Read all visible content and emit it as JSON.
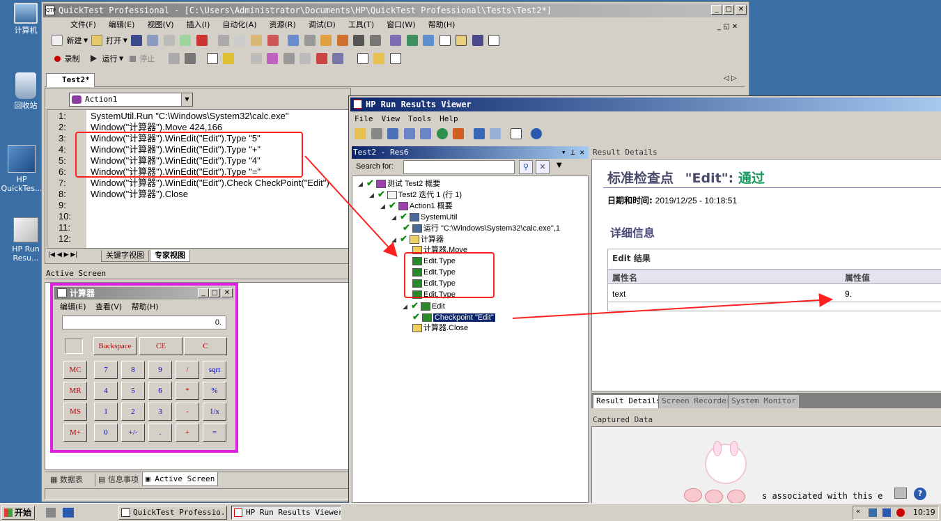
{
  "desktop": {
    "icons": [
      {
        "label": "计算机"
      },
      {
        "label": "回收站"
      },
      {
        "label": "HP QuickTes..."
      },
      {
        "label": "HP Run Resu..."
      }
    ]
  },
  "qtp": {
    "title": "QuickTest Professional - [C:\\Users\\Administrator\\Documents\\HP\\QuickTest Professional\\Tests\\Test2*]",
    "menu": [
      "文件(F)",
      "编辑(E)",
      "视图(V)",
      "插入(I)",
      "自动化(A)",
      "资源(R)",
      "调试(D)",
      "工具(T)",
      "窗口(W)",
      "帮助(H)"
    ],
    "toolbar": {
      "new": "新建",
      "open": "打开",
      "record": "录制",
      "run": "运行",
      "stop": "停止"
    },
    "doc_tab": "Test2*",
    "action_select": "Action1",
    "code_lines": [
      {
        "n": "1:",
        "t": "SystemUtil.Run \"C:\\Windows\\System32\\calc.exe\""
      },
      {
        "n": "2:",
        "t": "Window(\"计算器\").Move 424,166"
      },
      {
        "n": "3:",
        "t": "Window(\"计算器\").WinEdit(\"Edit\").Type \"5\""
      },
      {
        "n": "4:",
        "t": "Window(\"计算器\").WinEdit(\"Edit\").Type \"+\""
      },
      {
        "n": "5:",
        "t": "Window(\"计算器\").WinEdit(\"Edit\").Type \"4\""
      },
      {
        "n": "6:",
        "t": "Window(\"计算器\").WinEdit(\"Edit\").Type \"=\""
      },
      {
        "n": "7:",
        "t": "Window(\"计算器\").WinEdit(\"Edit\").Check CheckPoint(\"Edit\")"
      },
      {
        "n": "8:",
        "t": "Window(\"计算器\").Close"
      },
      {
        "n": "9:",
        "t": ""
      },
      {
        "n": "10:",
        "t": ""
      },
      {
        "n": "11:",
        "t": ""
      },
      {
        "n": "12:",
        "t": ""
      }
    ],
    "view_tabs": [
      "关键字视图",
      "专家视图"
    ],
    "active_screen_label": "Active Screen",
    "bottom_tabs": [
      "数据表",
      "信息事项",
      "Active Screen"
    ]
  },
  "calculator": {
    "title": "计算器",
    "menu": [
      "编辑(E)",
      "查看(V)",
      "帮助(H)"
    ],
    "display": "0.",
    "top_keys": [
      "Backspace",
      "CE",
      "C"
    ],
    "rows": [
      [
        "MC",
        "7",
        "8",
        "9",
        "/",
        "sqrt"
      ],
      [
        "MR",
        "4",
        "5",
        "6",
        "*",
        "%"
      ],
      [
        "MS",
        "1",
        "2",
        "3",
        "-",
        "1/x"
      ],
      [
        "M+",
        "0",
        "+/-",
        ".",
        "+",
        "="
      ]
    ]
  },
  "viewer": {
    "title": "HP Run Results Viewer",
    "menu": [
      "File",
      "View",
      "Tools",
      "Help"
    ],
    "panel_title": "Test2 - Res6",
    "search_label": "Search for:",
    "search_value": "",
    "tree": [
      "测试 Test2 概要",
      "Test2 迭代 1 (行 1)",
      "Action1 概要",
      "SystemUtil",
      "运行 \"C:\\Windows\\System32\\calc.exe\",1",
      "计算器",
      "计算器.Move",
      "Edit.Type",
      "Edit.Type",
      "Edit.Type",
      "Edit.Type",
      "Edit",
      "Checkpoint \"Edit\"",
      "计算器.Close"
    ],
    "details_header": "Result Details",
    "checkpoint_title_prefix": "标准检查点",
    "checkpoint_name": "\"Edit\":",
    "checkpoint_status": "通过",
    "datetime_label": "日期和时间:",
    "datetime_value": "2019/12/25 - 10:18:51",
    "detail_info": "详细信息",
    "edit_result": "Edit 结果",
    "prop_name_header": "属性名",
    "prop_value_header": "属性值",
    "prop_name": "text",
    "prop_value": "9.",
    "tabs": [
      "Result Details",
      "Screen Recorder",
      "System Monitor"
    ],
    "captured_header": "Captured Data",
    "captured_text": "s associated with this e"
  },
  "taskbar": {
    "start": "开始",
    "items": [
      "QuickTest Professio...",
      "HP Run Results Viewer"
    ],
    "clock": "10:19"
  },
  "colors": {
    "accent": "#0a246a",
    "pass": "#1a9a60",
    "highlight": "#ff2020",
    "magenta": "#e020e0"
  }
}
